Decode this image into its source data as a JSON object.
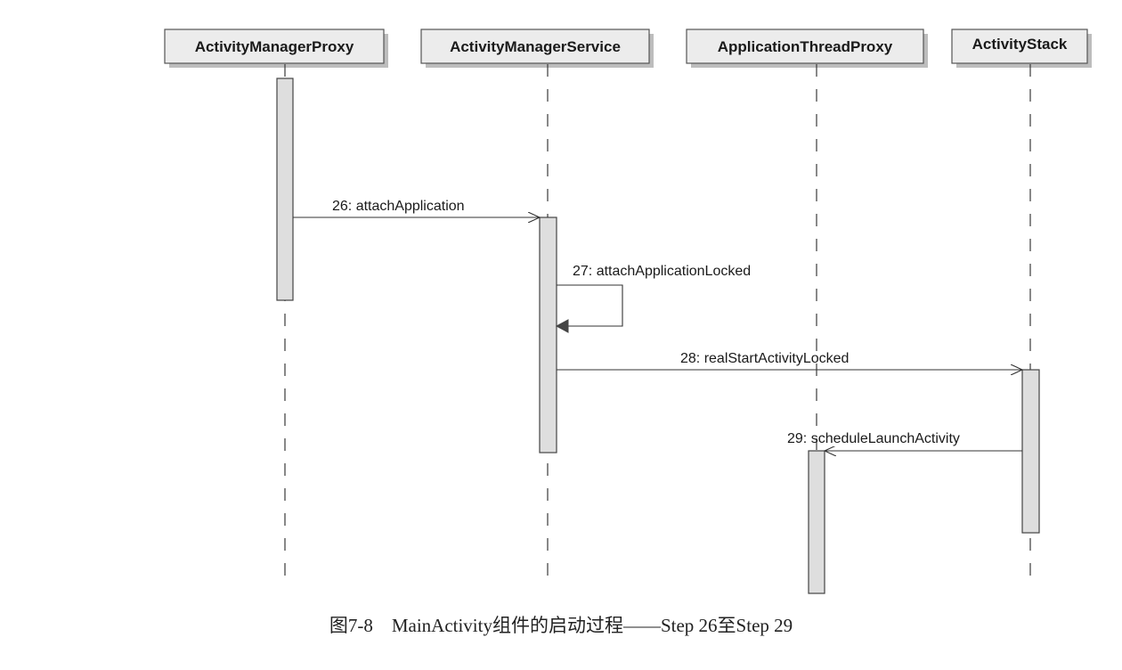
{
  "participants": [
    {
      "name": "ActivityManagerProxy"
    },
    {
      "name": "ActivityManagerService"
    },
    {
      "name": "ApplicationThreadProxy"
    },
    {
      "name": "ActivityStack"
    }
  ],
  "messages": [
    {
      "label": "26: attachApplication",
      "from": 0,
      "to": 1,
      "kind": "call"
    },
    {
      "label": "27: attachApplicationLocked",
      "from": 1,
      "to": 1,
      "kind": "self"
    },
    {
      "label": "28: realStartActivityLocked",
      "from": 1,
      "to": 3,
      "kind": "call"
    },
    {
      "label": "29: scheduleLaunchActivity",
      "from": 3,
      "to": 2,
      "kind": "call"
    }
  ],
  "caption": "图7-8　MainActivity组件的启动过程——Step 26至Step 29"
}
